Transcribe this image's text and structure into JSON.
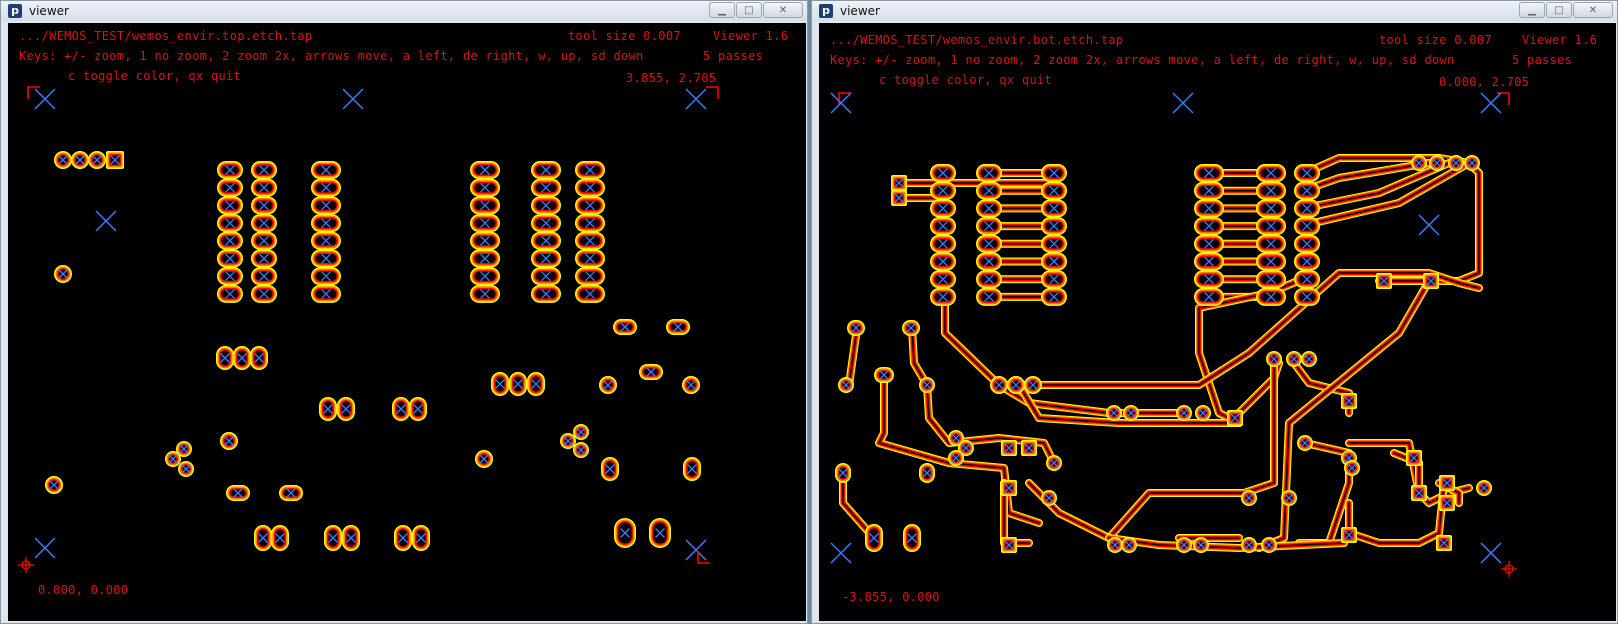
{
  "windows": [
    {
      "title": "viewer",
      "file": ".../WEMOS_TEST/wemos_envir.top.etch.tap",
      "tool_size": "tool size  0.007",
      "version": "Viewer 1.6",
      "keys": "Keys: +/- zoom, 1 no zoom, 2 zoom 2x, arrows move, a left, de right, w, up, sd down",
      "passes": "5 passes",
      "keys2": "c toggle color, qx quit",
      "coords_top": "3.855,  2.705",
      "coords_bottom": "0.000,  0.000"
    },
    {
      "title": "viewer",
      "file": ".../WEMOS_TEST/wemos_envir.bot.etch.tap",
      "tool_size": "tool size  0.007",
      "version": "Viewer 1.6",
      "keys": "Keys: +/- zoom, 1 no zoom, 2 zoom 2x, arrows move, a left, de right, w, up, sd down",
      "passes": "5 passes",
      "keys2": "c toggle color, qx quit",
      "coords_top": "0.000,  2.705",
      "coords_bottom": "-3.855,  0.000"
    }
  ],
  "colors": {
    "outer": "#ffff00",
    "mid": "#ff8000",
    "inner": "#ff0000",
    "marker": "#3a7bff",
    "hud": "#e01010"
  },
  "icons": [
    "p-app-icon",
    "minimize-icon",
    "maximize-icon",
    "close-icon",
    "crosshair-icon",
    "x-marker-icon"
  ]
}
